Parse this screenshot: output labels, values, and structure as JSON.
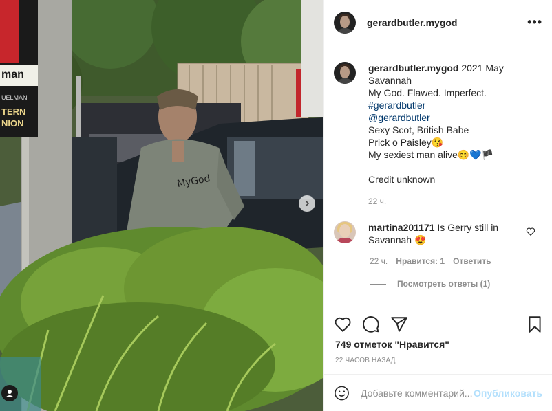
{
  "post": {
    "username": "gerardbutler.mygod",
    "photo_watermark": "MyGod",
    "sign_text": [
      "man",
      "UELMAN",
      "TERN",
      "NION"
    ]
  },
  "caption": {
    "username": "gerardbutler.mygod",
    "lines": [
      "2021 May",
      "Savannah",
      "My God. Flawed. Imperfect.",
      "#gerardbutler",
      "@gerardbutler",
      "Sexy Scot, British Babe",
      "Prick o Paisley😘",
      "My sexiest man alive😊💙🏴",
      "",
      "Credit unknown"
    ],
    "time": "22 ч."
  },
  "comment": {
    "username": "martina201171",
    "text": "Is Gerry still in Savannah 😍",
    "time": "22 ч.",
    "likes": "Нравится: 1",
    "reply": "Ответить",
    "view_replies": "Посмотреть ответы (1)"
  },
  "actions": {
    "likes": "749 отметок \"Нравится\"",
    "ago": "22 ЧАСОВ НАЗАД"
  },
  "add_comment": {
    "placeholder": "Добавьте комментарий...",
    "post_label": "Опубликовать"
  },
  "colors": {
    "link": "#00376b",
    "muted": "#8e8e8e",
    "post_disabled": "#b2dffc"
  }
}
